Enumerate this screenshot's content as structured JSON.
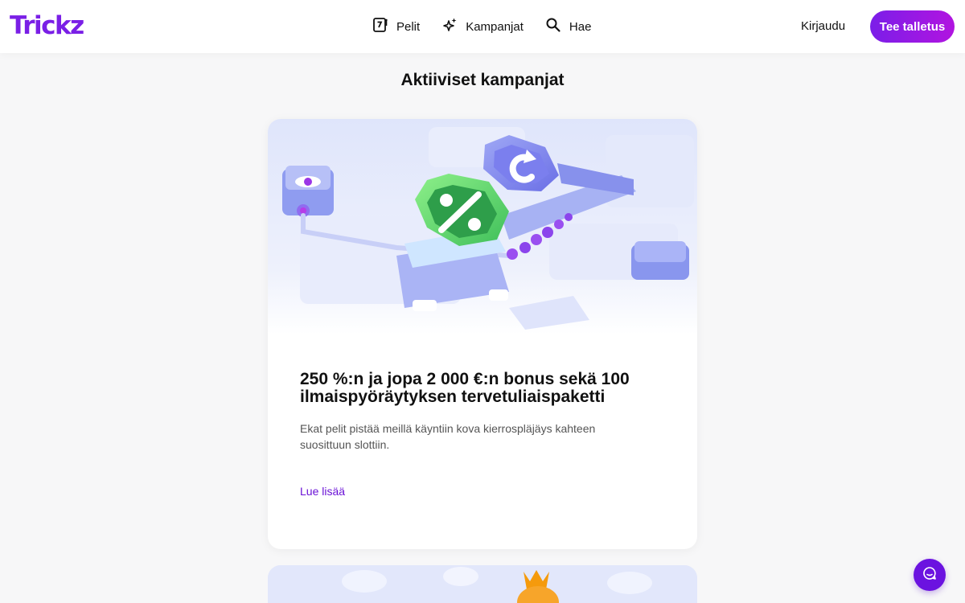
{
  "header": {
    "logo": "Trickz",
    "nav": [
      {
        "label": "Pelit",
        "icon": "slot-seven-icon"
      },
      {
        "label": "Kampanjat",
        "icon": "sparkles-icon"
      },
      {
        "label": "Hae",
        "icon": "search-icon"
      }
    ],
    "login_label": "Kirjaudu",
    "deposit_label": "Tee talletus"
  },
  "main": {
    "title": "Aktiiviset kampanjat",
    "promotions": [
      {
        "title": "250 %:n ja jopa 2 000 €:n bonus sekä 100 ilmaispyöräytyksen tervetuliaispaketti",
        "description": "Ekat pelit pistää meillä käyntiin kova kierrospläjäys kahteen suosittuun slottiin.",
        "link_label": "Lue lisää"
      }
    ]
  },
  "chat": {
    "icon": "chat-icon"
  },
  "colors": {
    "brand": "#7a1fe6",
    "link": "#6a12d6",
    "background": "#f7f7f8"
  }
}
